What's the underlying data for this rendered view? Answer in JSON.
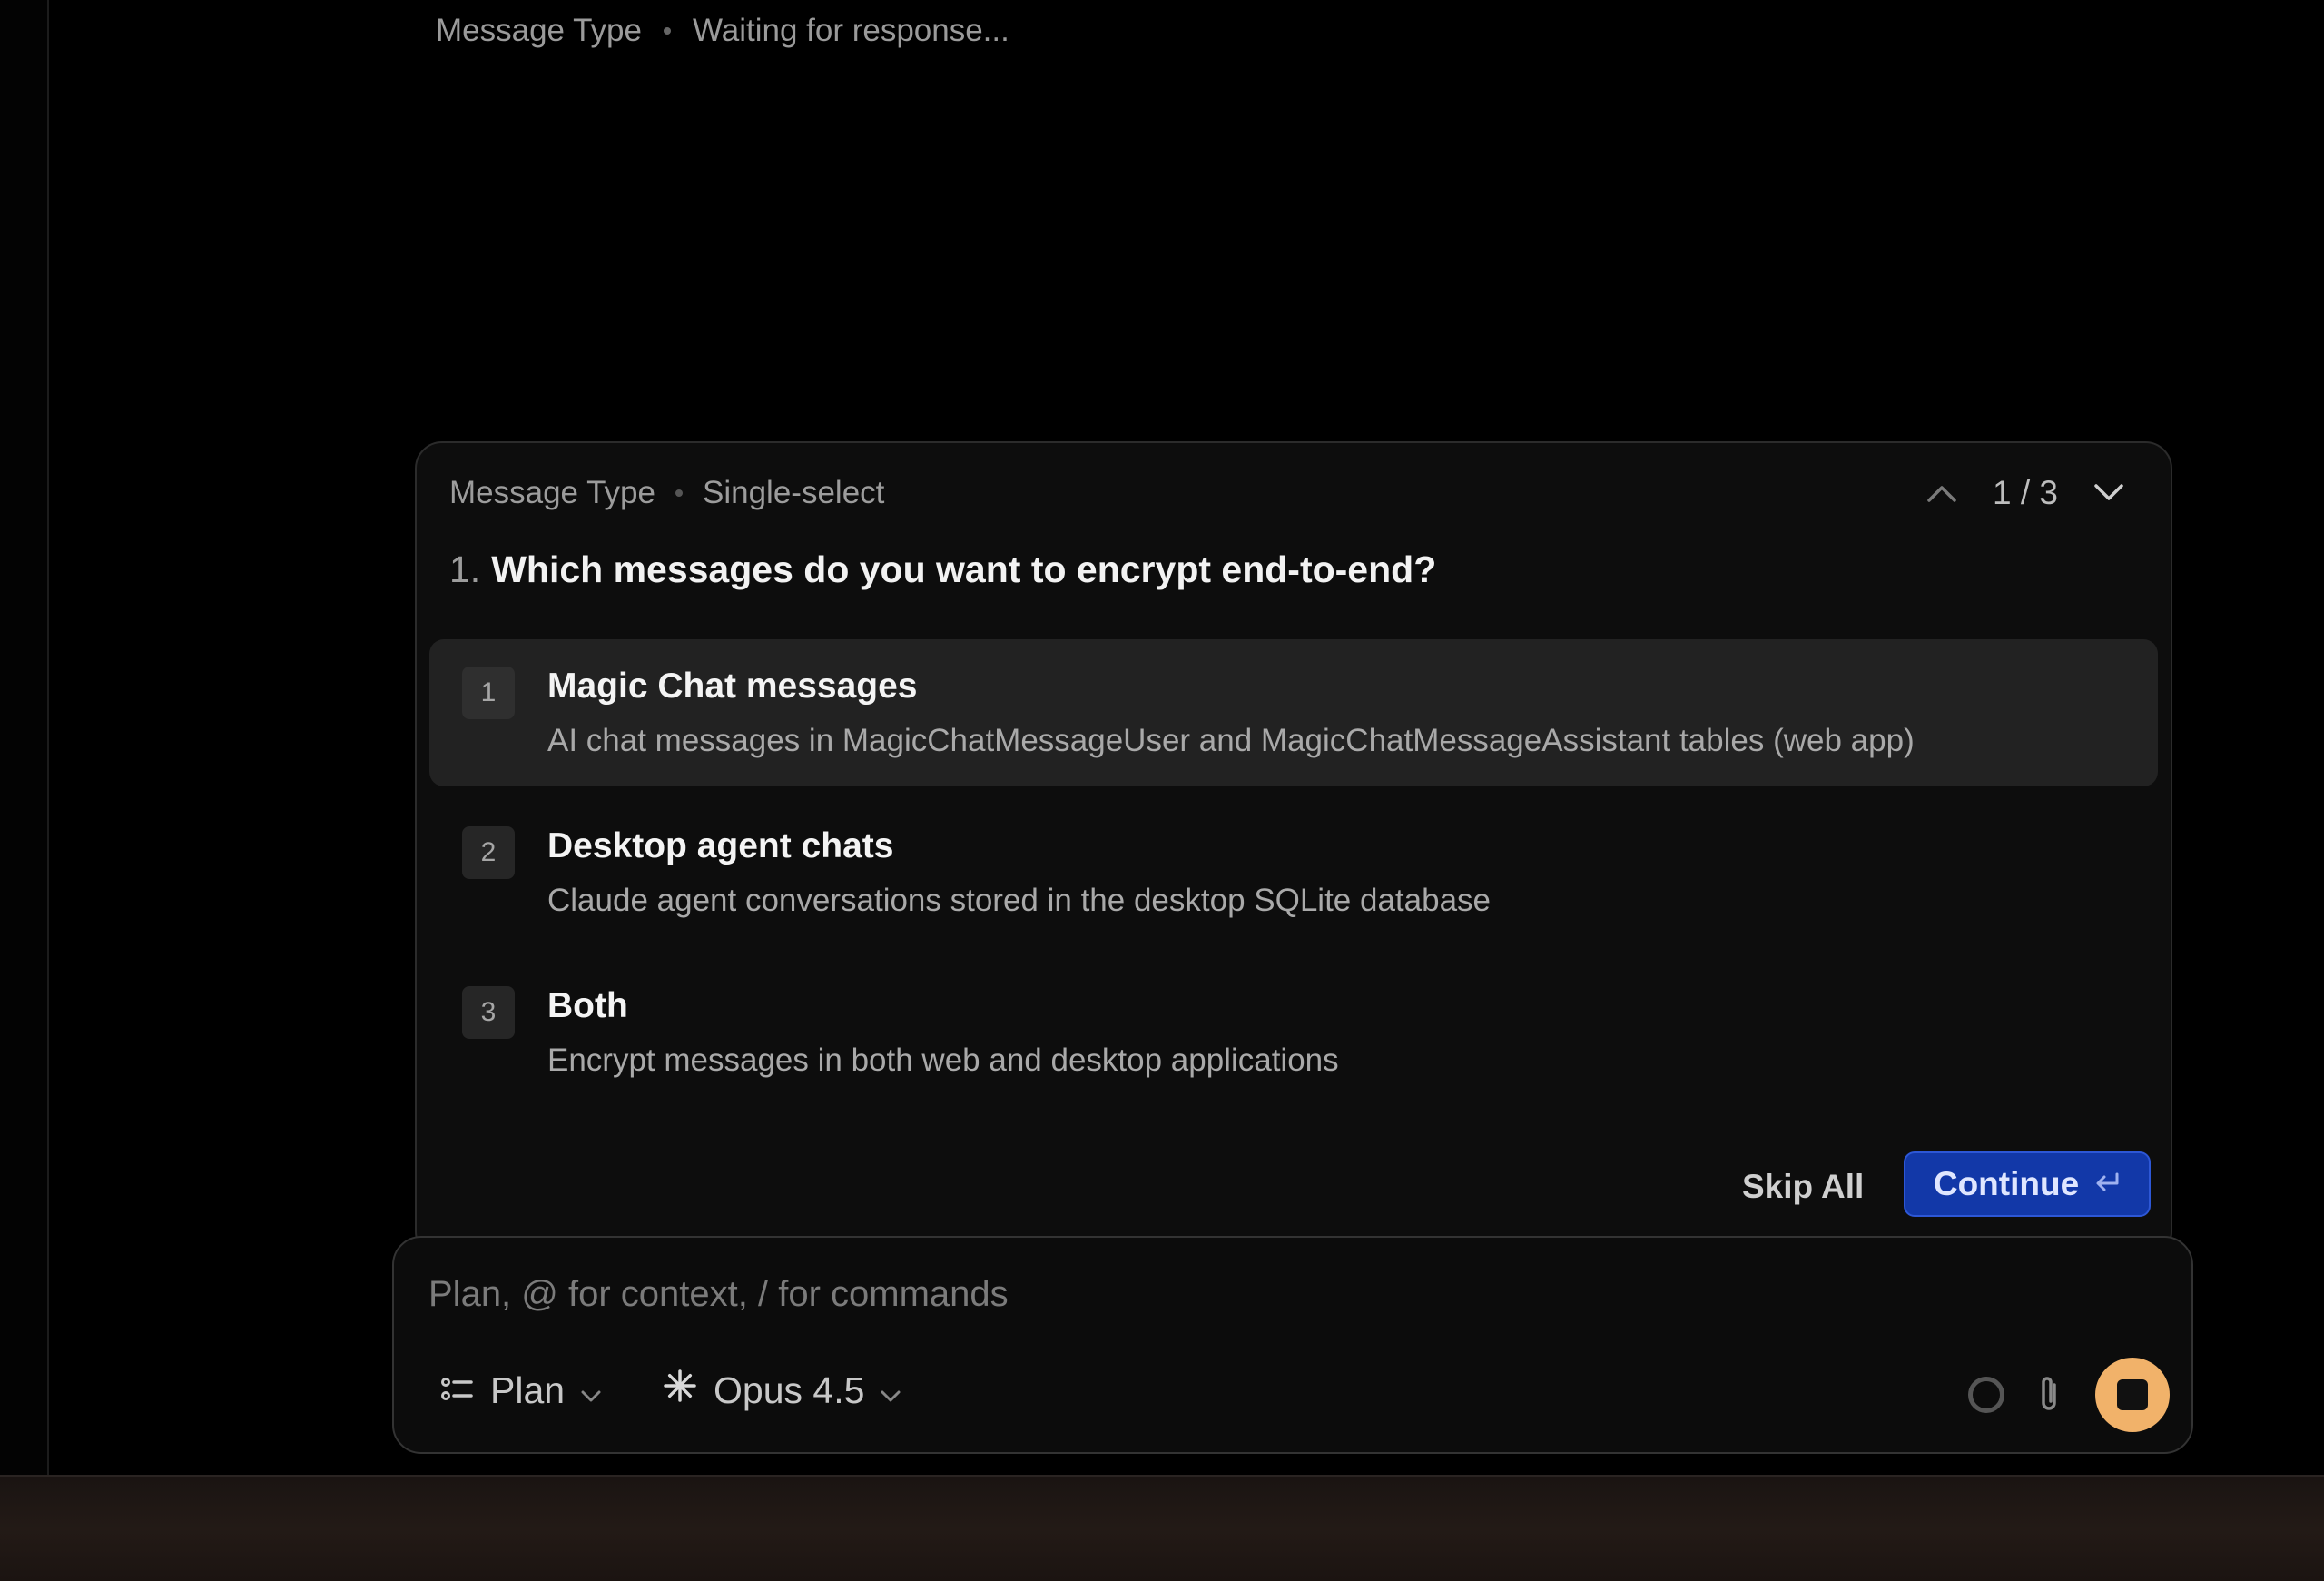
{
  "status": {
    "label": "Message Type",
    "state": "Waiting for response..."
  },
  "question": {
    "category": "Message Type",
    "mode": "Single-select",
    "pager": "1 / 3",
    "number": "1.",
    "title": "Which messages do you want to encrypt end-to-end?",
    "options": [
      {
        "index": "1",
        "title": "Magic Chat messages",
        "desc": "AI chat messages in MagicChatMessageUser and MagicChatMessageAssistant tables (web app)",
        "selected": true
      },
      {
        "index": "2",
        "title": "Desktop agent chats",
        "desc": "Claude agent conversations stored in the desktop SQLite database",
        "selected": false
      },
      {
        "index": "3",
        "title": "Both",
        "desc": "Encrypt messages in both web and desktop applications",
        "selected": false
      }
    ],
    "skip_label": "Skip All",
    "continue_label": "Continue"
  },
  "composer": {
    "placeholder": "Plan, @ for context, / for commands",
    "mode_label": "Plan",
    "model_label": "Opus 4.5",
    "icons": [
      "plan-list-icon",
      "chevron-down-icon",
      "sparkle-icon",
      "circle-status-icon",
      "paperclip-icon",
      "stop-icon"
    ]
  },
  "colors": {
    "accent_blue": "#1238a8",
    "stop_orange": "#f1b26a",
    "selected_bg": "#222222"
  }
}
